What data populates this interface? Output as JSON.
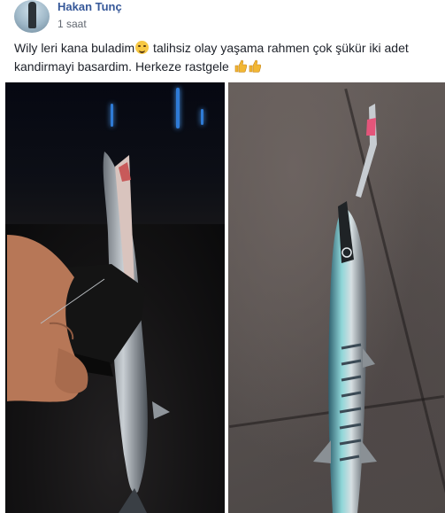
{
  "post": {
    "author": "Hakan Tunç",
    "time": "1 saat",
    "text_line1_a": "Wily leri kana buladim",
    "text_line1_b": " talihsiz olay yaşama rahmen çok şükür iki adet",
    "text_line2": "kandirmayi basardim. Herkeze rastgele ",
    "emoji_1": "smiling-face-icon",
    "emoji_2": "thumbs-up-icon"
  },
  "colors": {
    "author_link": "#365899",
    "body_text": "#1d2129",
    "meta_text": "#616770"
  },
  "photos": [
    {
      "name": "photo-fish-night"
    },
    {
      "name": "photo-fish-ground"
    }
  ]
}
